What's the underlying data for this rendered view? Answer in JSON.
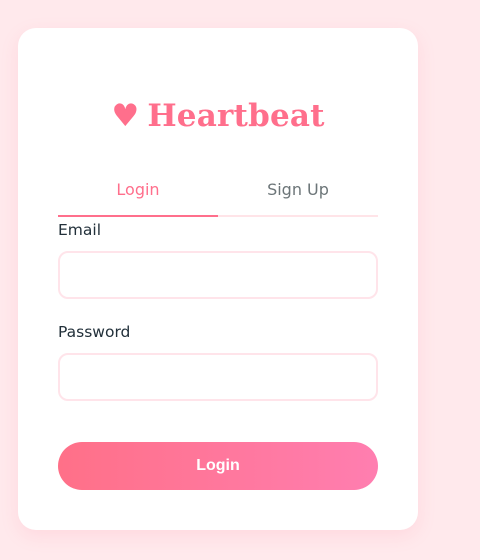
{
  "brand": {
    "icon": "heart-icon",
    "glyph": "♥",
    "name": "Heartbeat"
  },
  "tabs": [
    {
      "label": "Login",
      "active": true
    },
    {
      "label": "Sign Up",
      "active": false
    }
  ],
  "form": {
    "email_label": "Email",
    "email_value": "",
    "email_placeholder": "",
    "password_label": "Password",
    "password_value": "",
    "password_placeholder": "",
    "submit_label": "Login"
  },
  "colors": {
    "accent": "#ff6f8c",
    "accent_gradient_end": "#ff7eb0",
    "page_background": "#ffe9ec",
    "field_border": "#ffe4ea",
    "label_text": "#22303a",
    "inactive_tab_text": "#6c7578"
  }
}
